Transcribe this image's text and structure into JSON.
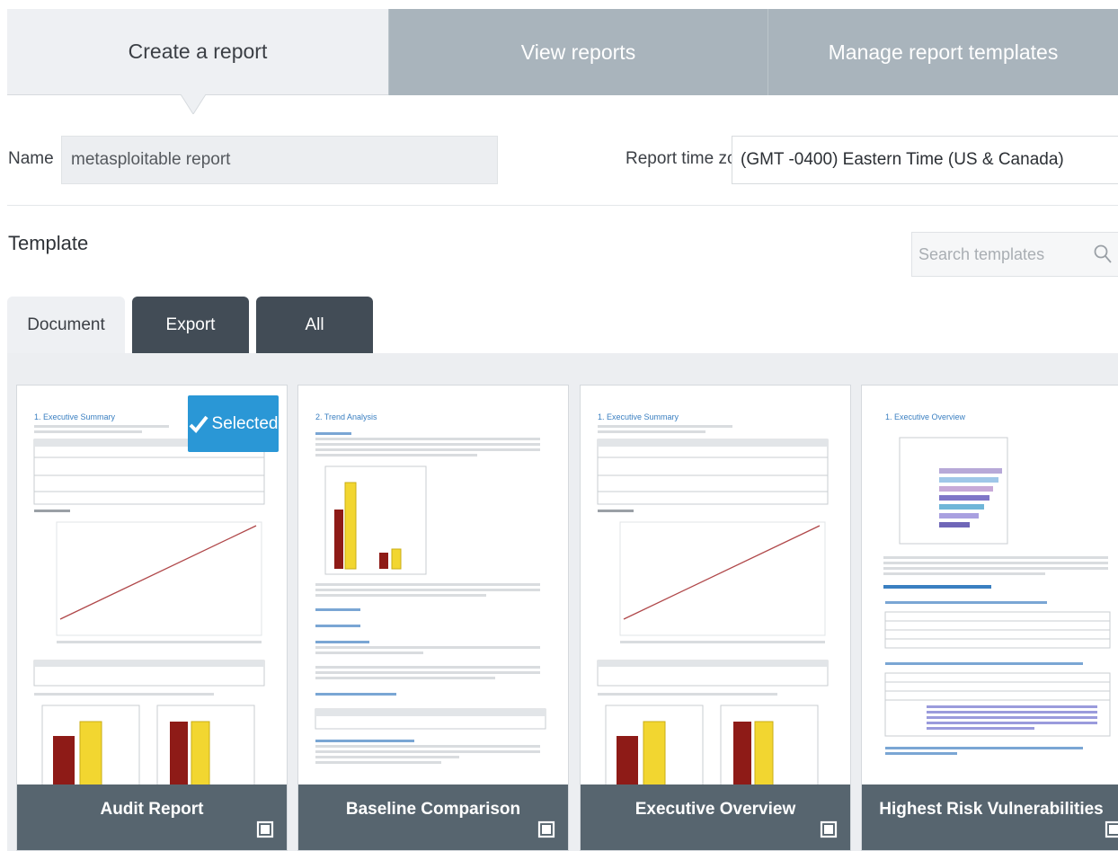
{
  "top_tabs": {
    "create": "Create a report",
    "view": "View reports",
    "manage": "Manage report templates"
  },
  "name_row": {
    "name_label": "Name",
    "name_value": "metasploitable report",
    "tz_label": "Report time zone",
    "tz_value": "(GMT -0400) Eastern Time (US & Canada)"
  },
  "template": {
    "title": "Template",
    "search_placeholder": "Search templates"
  },
  "sub_tabs": {
    "document": "Document",
    "export": "Export",
    "all": "All"
  },
  "cards": [
    {
      "label": "Audit Report",
      "selected": true,
      "selected_label": "Selected",
      "thumb_heading": "1. Executive Summary"
    },
    {
      "label": "Baseline Comparison",
      "selected": false,
      "thumb_heading": "2. Trend Analysis"
    },
    {
      "label": "Executive Overview",
      "selected": false,
      "thumb_heading": "1. Executive Summary"
    },
    {
      "label": "Highest Risk Vulnerabilities",
      "selected": false,
      "thumb_heading": "1. Executive Overview"
    }
  ],
  "colors": {
    "accent": "#2a97d6",
    "tab_inactive": "#a9b4bc",
    "tab_dark": "#424c56",
    "card_footer": "#57656f"
  }
}
